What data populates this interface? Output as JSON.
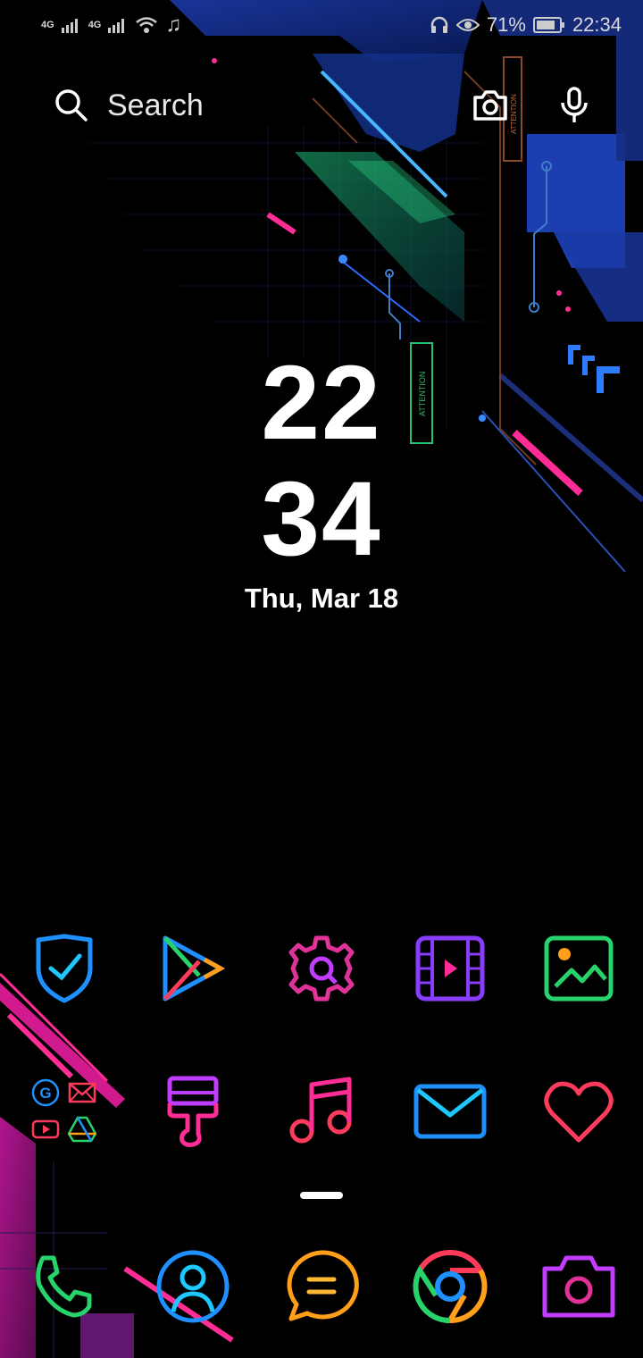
{
  "status_bar": {
    "network_1": "4G",
    "network_2": "4G",
    "battery_percent": "71%",
    "time": "22:34"
  },
  "search": {
    "placeholder": "Search"
  },
  "clock": {
    "hours": "22",
    "minutes": "34",
    "date": "Thu, Mar 18"
  },
  "apps_row1": [
    {
      "name": "security-icon"
    },
    {
      "name": "play-store-icon"
    },
    {
      "name": "settings-icon"
    },
    {
      "name": "videos-icon"
    },
    {
      "name": "gallery-icon"
    }
  ],
  "apps_row2": [
    {
      "name": "google-folder"
    },
    {
      "name": "themes-icon"
    },
    {
      "name": "music-icon"
    },
    {
      "name": "email-icon"
    },
    {
      "name": "health-icon"
    }
  ],
  "dock": [
    {
      "name": "phone-icon"
    },
    {
      "name": "contacts-icon"
    },
    {
      "name": "messages-icon"
    },
    {
      "name": "chrome-icon"
    },
    {
      "name": "camera-icon"
    }
  ],
  "colors": {
    "background": "#000000",
    "neon_blue": "#1e90ff",
    "neon_pink": "#ff2d95",
    "neon_purple": "#b026ff",
    "neon_green": "#27d36b",
    "neon_orange": "#ff9f1a"
  }
}
